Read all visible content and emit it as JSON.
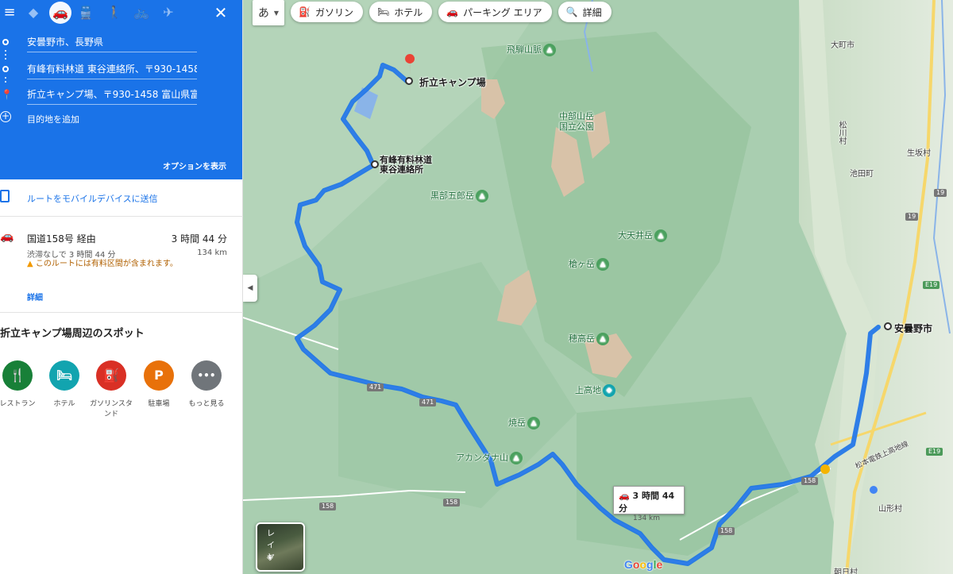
{
  "panel": {
    "modes": [
      "menu",
      "directions-best",
      "driving",
      "transit",
      "walking",
      "cycling",
      "flight"
    ],
    "waypoints": [
      "安曇野市、長野県",
      "有峰有料林道 東谷連絡所、〒930-1458",
      "折立キャンプ場、〒930-1458 富山県富"
    ],
    "add_destination": "目的地を追加",
    "options": "オプションを表示",
    "send_to_mobile": "ルートをモバイルデバイスに送信",
    "route": {
      "via": "国道158号 経由",
      "time": "3 時間 44 分",
      "distance": "134 km",
      "traffic": "渋滞なしで 3 時間 44 分",
      "warning": "このルートには有料区間が含まれます。",
      "details": "詳細"
    },
    "spots_title": "折立キャンプ場周辺のスポット",
    "spots": [
      {
        "label": "レストラン",
        "icon": "restaurant-icon",
        "color": "#188038",
        "glyph": "🍴"
      },
      {
        "label": "ホテル",
        "icon": "hotel-icon",
        "color": "#12a4af",
        "glyph": "🛏"
      },
      {
        "label": "ガソリンスタンド",
        "icon": "gas-station-icon",
        "color": "#d93025",
        "glyph": "⛽"
      },
      {
        "label": "駐車場",
        "icon": "parking-icon",
        "color": "#e8710a",
        "glyph": "P"
      },
      {
        "label": "もっと見る",
        "icon": "more-icon",
        "color": "#70757a",
        "glyph": "•••"
      }
    ]
  },
  "map": {
    "ime": "あ",
    "chips": [
      {
        "label": "ガソリン",
        "icon": "gas-icon"
      },
      {
        "label": "ホテル",
        "icon": "hotel-icon"
      },
      {
        "label": "パーキング エリア",
        "icon": "parking-area-icon"
      },
      {
        "label": "詳細",
        "icon": "search-icon"
      }
    ],
    "route_box": {
      "time": "3 時間 44 分",
      "distance": "134 km"
    },
    "layer_label": "レイヤ",
    "google": "Google",
    "labels": {
      "origin": "安曇野市",
      "via_point": "有峰有料林道\n東谷連絡所",
      "destination": "折立キャンプ場",
      "hidayama": "飛騨山脈",
      "chubu": "中部山岳\n国立公園",
      "kurobe": "黒部五郎岳",
      "otenjo": "大天井岳",
      "yari": "槍ヶ岳",
      "hotaka": "穂高岳",
      "kamikochi": "上高地",
      "yake": "焼岳",
      "akandana": "アカンダナ山",
      "omachi": "大町市",
      "matsukawa": "松川村",
      "ikeda": "池田町",
      "ikusaka": "生坂村",
      "yamagata": "山形村",
      "asahi": "朝日村",
      "railway": "松本電鉄上高地線"
    },
    "route_numbers": [
      "471",
      "471",
      "158",
      "158",
      "158",
      "158",
      "19",
      "19",
      "E19",
      "E19"
    ]
  }
}
